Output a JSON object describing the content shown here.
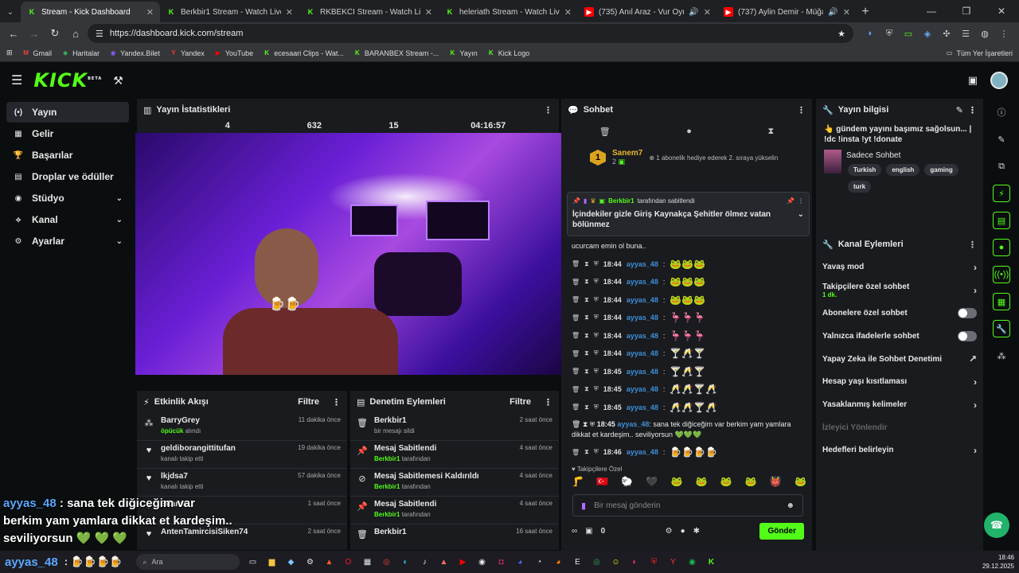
{
  "browser": {
    "tabs": [
      {
        "title": "Stream - Kick Dashboard",
        "icon": "kick",
        "active": true
      },
      {
        "title": "Berkbir1 Stream - Watch Live o",
        "icon": "kick"
      },
      {
        "title": "RKBEKCI Stream - Watch Live o",
        "icon": "kick"
      },
      {
        "title": "heleriath Stream - Watch Live o",
        "icon": "kick"
      },
      {
        "title": "(735) Anıl Araz - Vur Oynasın Te",
        "icon": "youtube"
      },
      {
        "title": "(737) Aylin Demir - Müğan",
        "icon": "youtube"
      }
    ],
    "url": "https://dashboard.kick.com/stream",
    "bookmarks": [
      {
        "label": "Gmail",
        "icon": "gmail"
      },
      {
        "label": "Haritalar",
        "icon": "maps"
      },
      {
        "label": "Yandex.Bilet",
        "icon": "yandex-bilet"
      },
      {
        "label": "Yandex",
        "icon": "yandex"
      },
      {
        "label": "YouTube",
        "icon": "youtube"
      },
      {
        "label": "ecesaari Clips - Wat...",
        "icon": "kick"
      },
      {
        "label": "BARANBEX Stream -...",
        "icon": "kick"
      },
      {
        "label": "Yayın",
        "icon": "kick"
      },
      {
        "label": "Kick Logo",
        "icon": "kick"
      }
    ],
    "bookmarks_right": "Tüm Yer İşaretleri"
  },
  "header": {
    "logo": "KICK",
    "beta": "BETA"
  },
  "nav": [
    {
      "label": "Yayın",
      "icon": "(•)",
      "active": true
    },
    {
      "label": "Gelir",
      "icon": "▦"
    },
    {
      "label": "Başarılar",
      "icon": "🏆"
    },
    {
      "label": "Droplar ve ödüller",
      "icon": "▤"
    },
    {
      "label": "Stüdyo",
      "icon": "◉",
      "expand": true
    },
    {
      "label": "Kanal",
      "icon": "⟡",
      "expand": true
    },
    {
      "label": "Ayarlar",
      "icon": "⚙",
      "expand": true
    }
  ],
  "stats": {
    "title": "Yayın İstatistikleri",
    "values": [
      "",
      "4",
      "632",
      "15",
      "04:16:57"
    ]
  },
  "activity": {
    "title": "Etkinlik Akışı",
    "filter": "Filtre",
    "items": [
      {
        "name": "BarryGrey",
        "sub_highlight": "öpücük",
        "sub": " alındı",
        "time": "11 dakika önce",
        "icon": "gift"
      },
      {
        "name": "geldiborangittitufan",
        "sub": "kanalı takip etti",
        "time": "19 dakika önce",
        "icon": "heart"
      },
      {
        "name": "lkjdsa7",
        "sub": "kanalı takip etti",
        "time": "57 dakika önce",
        "icon": "heart"
      },
      {
        "name": "Edanna",
        "sub": "",
        "time": "1 saat önce",
        "icon": "heart"
      },
      {
        "name": "AntenTamircisiSiken74",
        "sub": "",
        "time": "2 saat önce",
        "icon": "heart"
      }
    ]
  },
  "modlog": {
    "title": "Denetim Eylemleri",
    "filter": "Filtre",
    "items": [
      {
        "name": "Berkbir1",
        "sub": "bir mesajı sildi",
        "time": "2 saat önce",
        "icon": "trash"
      },
      {
        "name": "Mesaj Sabitlendi",
        "sub_highlight": "Berkbir1",
        "sub": " tarafından",
        "time": "4 saat önce",
        "icon": "pin"
      },
      {
        "name": "Mesaj Sabitlemesi Kaldırıldı",
        "sub_highlight": "Berkbir1",
        "sub": " tarafından",
        "time": "4 saat önce",
        "icon": "unpin"
      },
      {
        "name": "Mesaj Sabitlendi",
        "sub_highlight": "Berkbir1",
        "sub": " tarafından",
        "time": "4 saat önce",
        "icon": "pin"
      },
      {
        "name": "Berkbir1",
        "sub": "",
        "time": "16 saat önce",
        "icon": "trash"
      }
    ]
  },
  "chat": {
    "title": "Sohbet",
    "leader": {
      "rank": "1",
      "name": "Sanem7",
      "count": "2",
      "text": "1 abonelik hediye ederek 2. sıraya yükselin"
    },
    "pinned": {
      "by": "Berkbir1",
      "by_suffix": "tarafından sabitlendi",
      "text": "İçindekiler gizle Giriş Kaynakça Şehitler ölmez vatan bölünmez"
    },
    "first_line": "ucurcam emin ol buna..",
    "messages": [
      {
        "time": "18:44",
        "user": "ayyas_48",
        "emotes": "🐸🐸🐸"
      },
      {
        "time": "18:44",
        "user": "ayyas_48",
        "emotes": "🐸🐸🐸"
      },
      {
        "time": "18:44",
        "user": "ayyas_48",
        "emotes": "🐸🐸🐸"
      },
      {
        "time": "18:44",
        "user": "ayyas_48",
        "emotes": "🦩🦩🦩"
      },
      {
        "time": "18:44",
        "user": "ayyas_48",
        "emotes": "🦩🦩🦩"
      },
      {
        "time": "18:44",
        "user": "ayyas_48",
        "emotes": "🍸🥂🍸"
      },
      {
        "time": "18:45",
        "user": "ayyas_48",
        "emotes": "🍸🥂🍸"
      },
      {
        "time": "18:45",
        "user": "ayyas_48",
        "emotes": "🥂🥂🍸🥂"
      },
      {
        "time": "18:45",
        "user": "ayyas_48",
        "emotes": "🥂🥂🍸🥂"
      }
    ],
    "long_msg": {
      "time": "18:45",
      "user": "ayyas_48",
      "text": "sana tek diğiceğim var berkim yam yamlara dikkat et kardeşim.. seviliyorsun 💚💚💚"
    },
    "last_msg": {
      "time": "18:46",
      "user": "ayyas_48",
      "emotes": "🍺🍺🍺🍺"
    },
    "followers_only": "Takipçilere Özel",
    "emote_bar": [
      "🦵",
      "🇹🇷",
      "🐑",
      "🖤",
      "🐸",
      "🐸",
      "🐸",
      "🐸",
      "👹",
      "🐸"
    ],
    "placeholder": "Bir mesaj gönderin",
    "points": "0",
    "send": "Gönder"
  },
  "info": {
    "title": "Yayın bilgisi",
    "text": "👆 gündem yayını başımız sağolsun... | !dc !insta !yt !donate",
    "category": "Sadece Sohbet",
    "tags": [
      "Turkish",
      "english",
      "gaming",
      "turk"
    ]
  },
  "actions": {
    "title": "Kanal Eylemleri",
    "items": [
      {
        "label": "Yavaş mod",
        "type": "arrow"
      },
      {
        "label": "Takipçilere özel sohbet",
        "sub": "1 dk.",
        "type": "arrow"
      },
      {
        "label": "Abonelere özel sohbet",
        "type": "toggle"
      },
      {
        "label": "Yalnızca ifadelerle sohbet",
        "type": "toggle"
      },
      {
        "label": "Yapay Zeka ile Sohbet Denetimi",
        "type": "external"
      },
      {
        "label": "Hesap yaşı kısıtlaması",
        "type": "arrow"
      },
      {
        "label": "Yasaklanmış kelimeler",
        "type": "arrow"
      },
      {
        "label": "İzleyici Yönlendir",
        "type": "disabled"
      },
      {
        "label": "Hedefleri belirleyin",
        "type": "arrow"
      }
    ]
  },
  "overlay": {
    "line1_user": "ayyas_48",
    "line1": " : sana tek diğiceğim var",
    "line2": "berkim yam yamlara dikkat et kardeşim..",
    "line3": "seviliyorsun 💚 💚 💚",
    "line4_user": "ayyas_48",
    "line4": " : 🍺🍺🍺🍺"
  },
  "taskbar": {
    "search": "Ara",
    "time": "18:46",
    "date": "29.12.2025"
  }
}
